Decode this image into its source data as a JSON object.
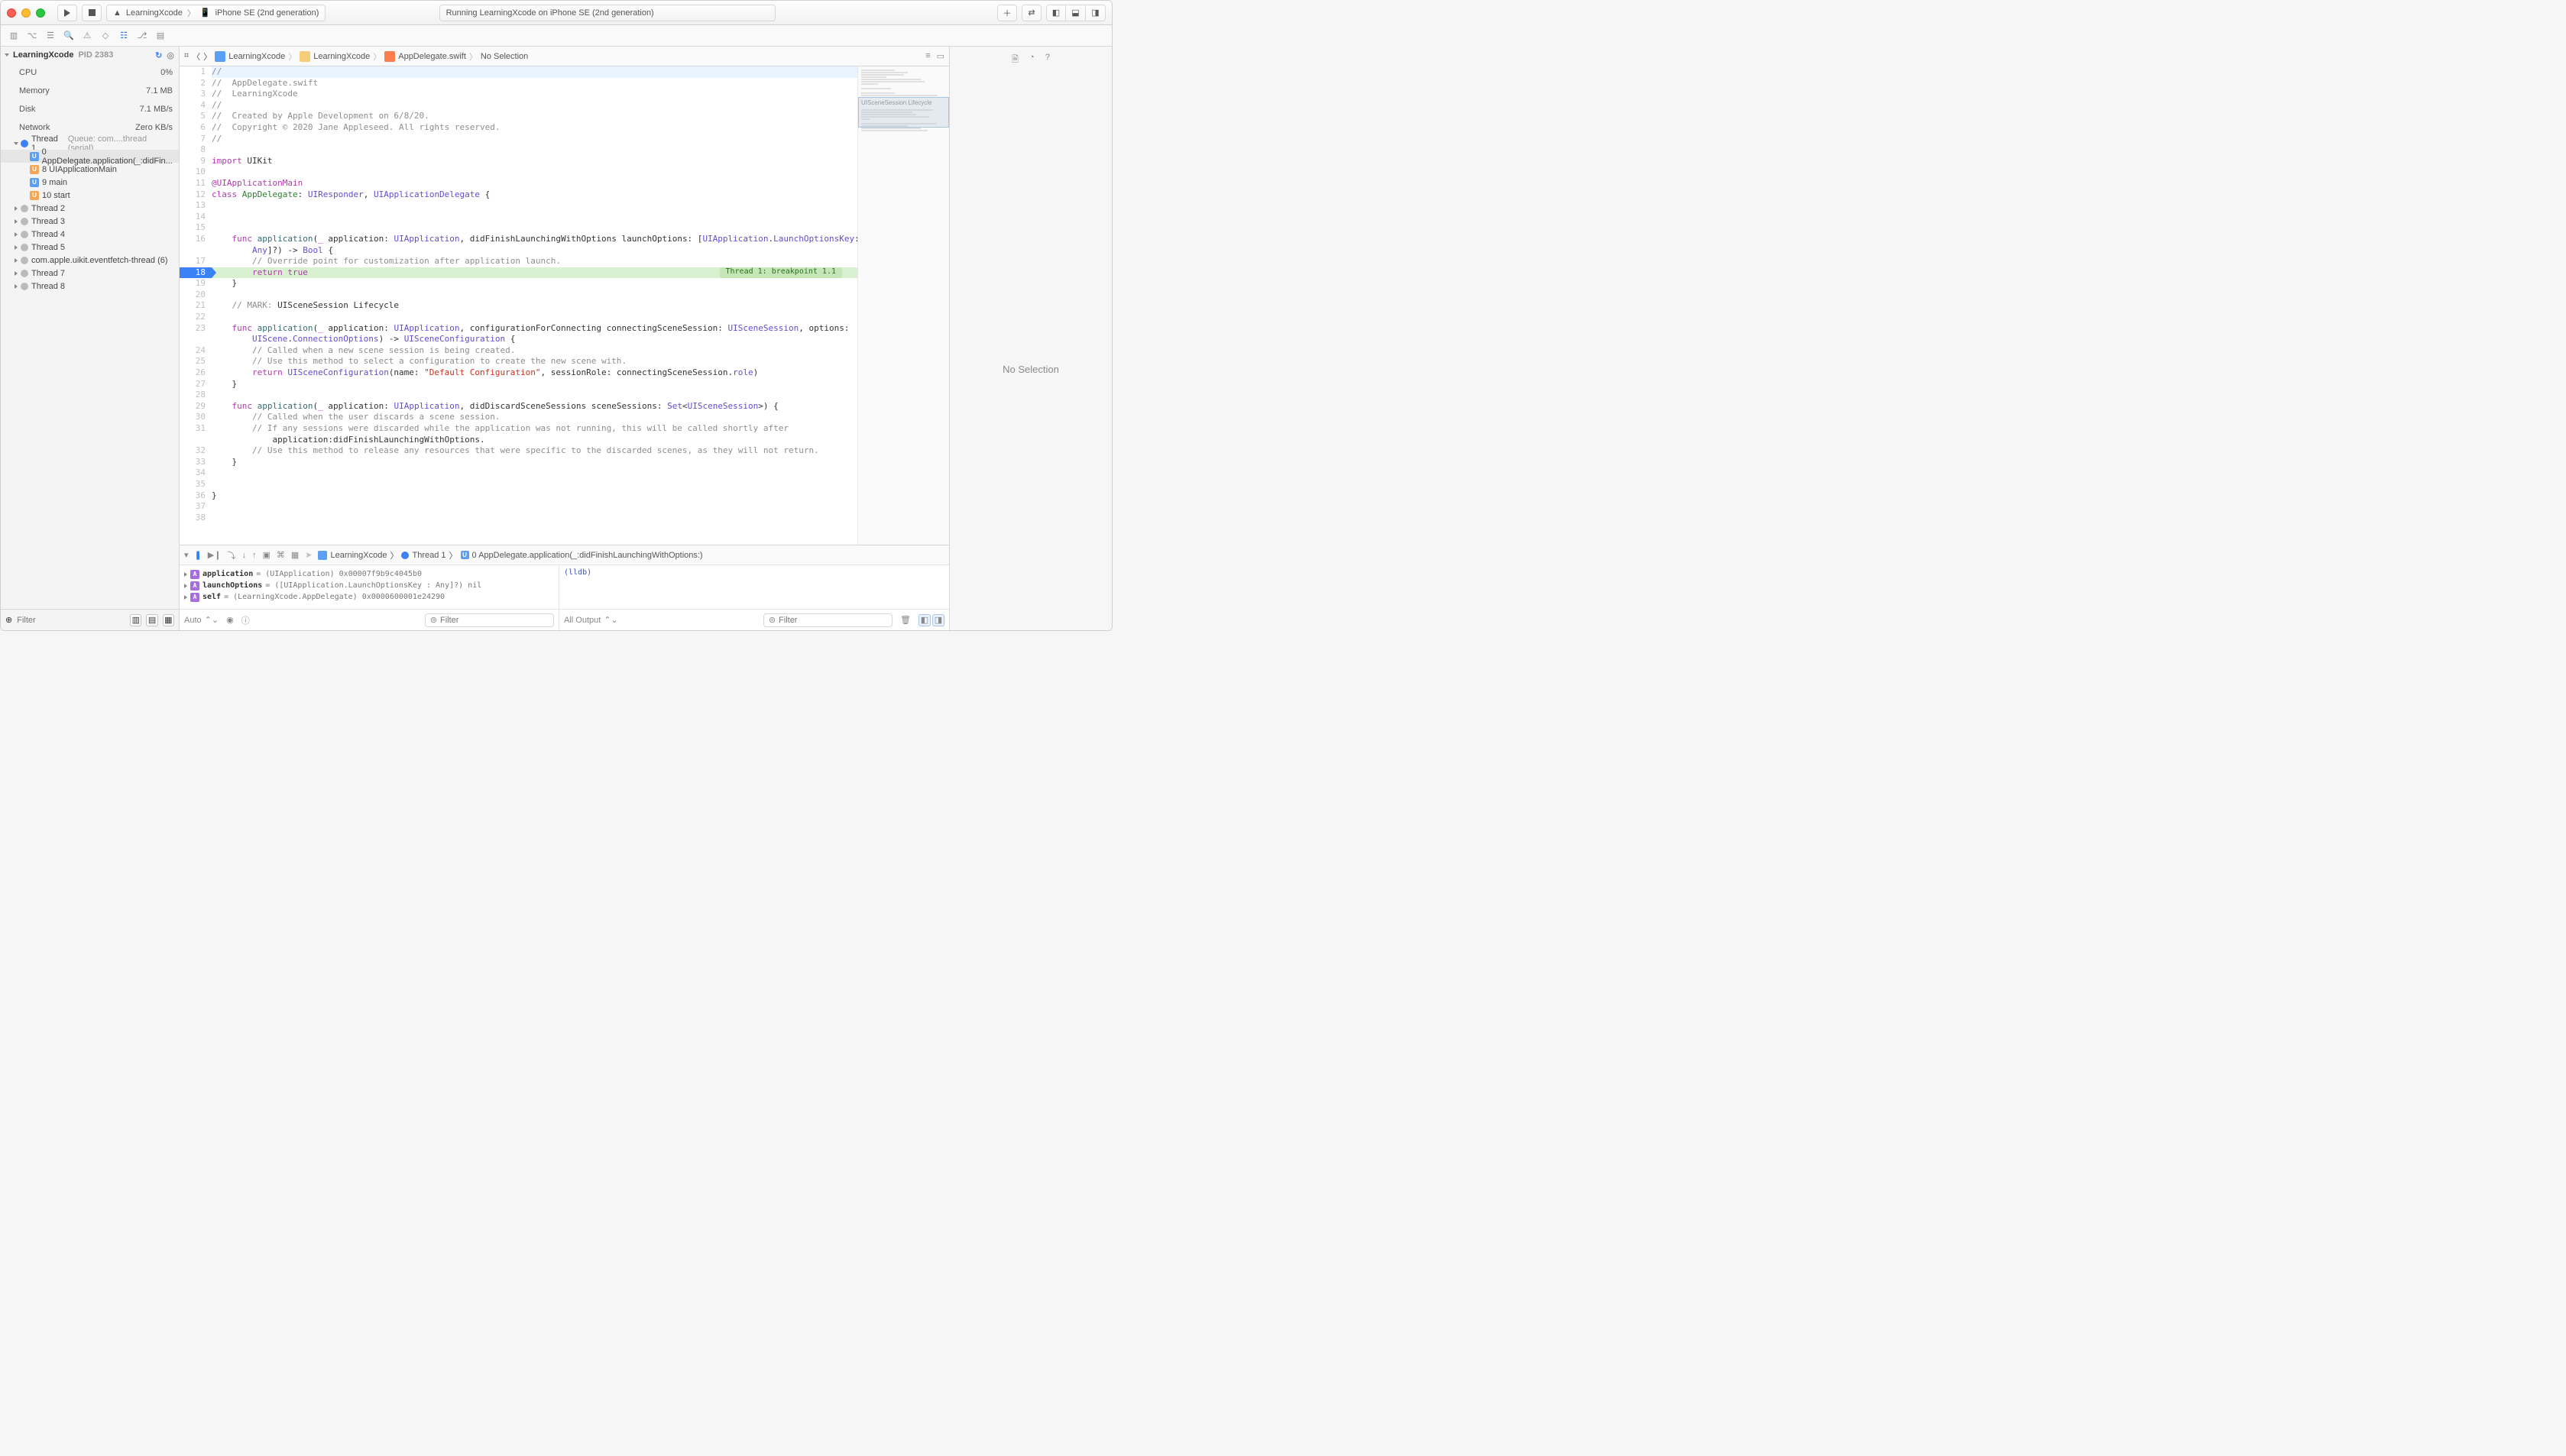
{
  "toolbar": {
    "scheme": "LearningXcode",
    "destination": "iPhone SE (2nd generation)",
    "status": "Running LearningXcode on iPhone SE (2nd generation)"
  },
  "navigator": {
    "process": "LearningXcode",
    "pid": "PID 2383",
    "metrics": {
      "cpu_label": "CPU",
      "cpu_value": "0%",
      "mem_label": "Memory",
      "mem_value": "7.1 MB",
      "disk_label": "Disk",
      "disk_value": "7.1 MB/s",
      "net_label": "Network",
      "net_value": "Zero KB/s"
    },
    "thread1": {
      "label": "Thread 1",
      "queue": "Queue: com....thread (serial)",
      "frames": [
        "0 AppDelegate.application(_:didFin...",
        "8 UIApplicationMain",
        "9 main",
        "10 start"
      ]
    },
    "threads": [
      "Thread 2",
      "Thread 3",
      "Thread 4",
      "Thread 5",
      "com.apple.uikit.eventfetch-thread (6)",
      "Thread 7",
      "Thread 8"
    ],
    "filter_placeholder": "Filter"
  },
  "jumpbar": {
    "proj": "LearningXcode",
    "folder": "LearningXcode",
    "file": "AppDelegate.swift",
    "selection": "No Selection"
  },
  "breakpoint_badge": "Thread 1: breakpoint 1.1",
  "minimap_section": "UISceneSession Lifecycle",
  "debug": {
    "crumb_proj": "LearningXcode",
    "crumb_thread": "Thread 1",
    "crumb_frame": "0 AppDelegate.application(_:didFinishLaunchingWithOptions:)",
    "vars": [
      {
        "name": "application",
        "rest": " = (UIApplication) 0x00007f9b9c4045b0"
      },
      {
        "name": "launchOptions",
        "rest": " = ([UIApplication.LaunchOptionsKey : Any]?) nil"
      },
      {
        "name": "self",
        "rest": " = (LearningXcode.AppDelegate) 0x0000600001e24290"
      }
    ],
    "console": "(lldb)",
    "auto": "Auto",
    "all_output": "All Output",
    "filter_placeholder": "Filter"
  },
  "inspector": {
    "empty": "No Selection"
  },
  "code": [
    {
      "n": 1,
      "h": "<span class='c-comment'>//</span>",
      "cls": "bp-active"
    },
    {
      "n": 2,
      "h": "<span class='c-comment'>//  AppDelegate.swift</span>"
    },
    {
      "n": 3,
      "h": "<span class='c-comment'>//  LearningXcode</span>"
    },
    {
      "n": 4,
      "h": "<span class='c-comment'>//</span>"
    },
    {
      "n": 5,
      "h": "<span class='c-comment'>//  Created by Apple Development on 6/8/20.</span>"
    },
    {
      "n": 6,
      "h": "<span class='c-comment'>//  Copyright © 2020 Jane Appleseed. All rights reserved.</span>"
    },
    {
      "n": 7,
      "h": "<span class='c-comment'>//</span>"
    },
    {
      "n": 8,
      "h": ""
    },
    {
      "n": 9,
      "h": "<span class='c-kw'>import</span> UIKit"
    },
    {
      "n": 10,
      "h": ""
    },
    {
      "n": 11,
      "h": "<span class='c-attr'>@UIApplicationMain</span>"
    },
    {
      "n": 12,
      "h": "<span class='c-kw'>class</span> <span class='c-green'>AppDelegate</span>: <span class='c-type'>UIResponder</span>, <span class='c-type'>UIApplicationDelegate</span> {"
    },
    {
      "n": 13,
      "h": ""
    },
    {
      "n": 14,
      "h": ""
    },
    {
      "n": 15,
      "h": ""
    },
    {
      "n": 16,
      "h": "    <span class='c-kw'>func</span> <span class='c-func'>application</span>(<span class='c-kw'>_</span> application: <span class='c-type'>UIApplication</span>, didFinishLaunchingWithOptions launchOptions: [<span class='c-type'>UIApplication</span>.<span class='c-type'>LaunchOptionsKey</span>:\n        <span class='c-type'>Any</span>]?) -> <span class='c-type'>Bool</span> {"
    },
    {
      "n": 17,
      "h": "        <span class='c-comment'>// Override point for customization after application launch.</span>"
    },
    {
      "n": 18,
      "h": "        <span class='c-kw'>return</span> <span class='c-kw'>true</span>",
      "cls": "bp-marker exec-line",
      "badge": true
    },
    {
      "n": 19,
      "h": "    }"
    },
    {
      "n": 20,
      "h": ""
    },
    {
      "n": 21,
      "h": "    <span class='c-comment'>// MARK:</span> UISceneSession Lifecycle"
    },
    {
      "n": 22,
      "h": ""
    },
    {
      "n": 23,
      "h": "    <span class='c-kw'>func</span> <span class='c-func'>application</span>(<span class='c-kw'>_</span> application: <span class='c-type'>UIApplication</span>, configurationForConnecting connectingSceneSession: <span class='c-type'>UISceneSession</span>, options:\n        <span class='c-type'>UIScene</span>.<span class='c-type'>ConnectionOptions</span>) -> <span class='c-type'>UISceneConfiguration</span> {"
    },
    {
      "n": 24,
      "h": "        <span class='c-comment'>// Called when a new scene session is being created.</span>"
    },
    {
      "n": 25,
      "h": "        <span class='c-comment'>// Use this method to select a configuration to create the new scene with.</span>"
    },
    {
      "n": 26,
      "h": "        <span class='c-kw'>return</span> <span class='c-type'>UISceneConfiguration</span>(name: <span class='c-str'>\"Default Configuration\"</span>, sessionRole: connectingSceneSession.<span class='c-type'>role</span>)"
    },
    {
      "n": 27,
      "h": "    }"
    },
    {
      "n": 28,
      "h": ""
    },
    {
      "n": 29,
      "h": "    <span class='c-kw'>func</span> <span class='c-func'>application</span>(<span class='c-kw'>_</span> application: <span class='c-type'>UIApplication</span>, didDiscardSceneSessions sceneSessions: <span class='c-type'>Set</span>&lt;<span class='c-type'>UISceneSession</span>&gt;) {"
    },
    {
      "n": 30,
      "h": "        <span class='c-comment'>// Called when the user discards a scene session.</span>"
    },
    {
      "n": 31,
      "h": "        <span class='c-comment'>// If any sessions were discarded while the application was not running, this will be called shortly after\n            application:didFinishLaunchingWithOptions.</span>"
    },
    {
      "n": 32,
      "h": "        <span class='c-comment'>// Use this method to release any resources that were specific to the discarded scenes, as they will not return.</span>"
    },
    {
      "n": 33,
      "h": "    }"
    },
    {
      "n": 34,
      "h": ""
    },
    {
      "n": 35,
      "h": ""
    },
    {
      "n": 36,
      "h": "}"
    },
    {
      "n": 37,
      "h": ""
    },
    {
      "n": 38,
      "h": ""
    }
  ]
}
